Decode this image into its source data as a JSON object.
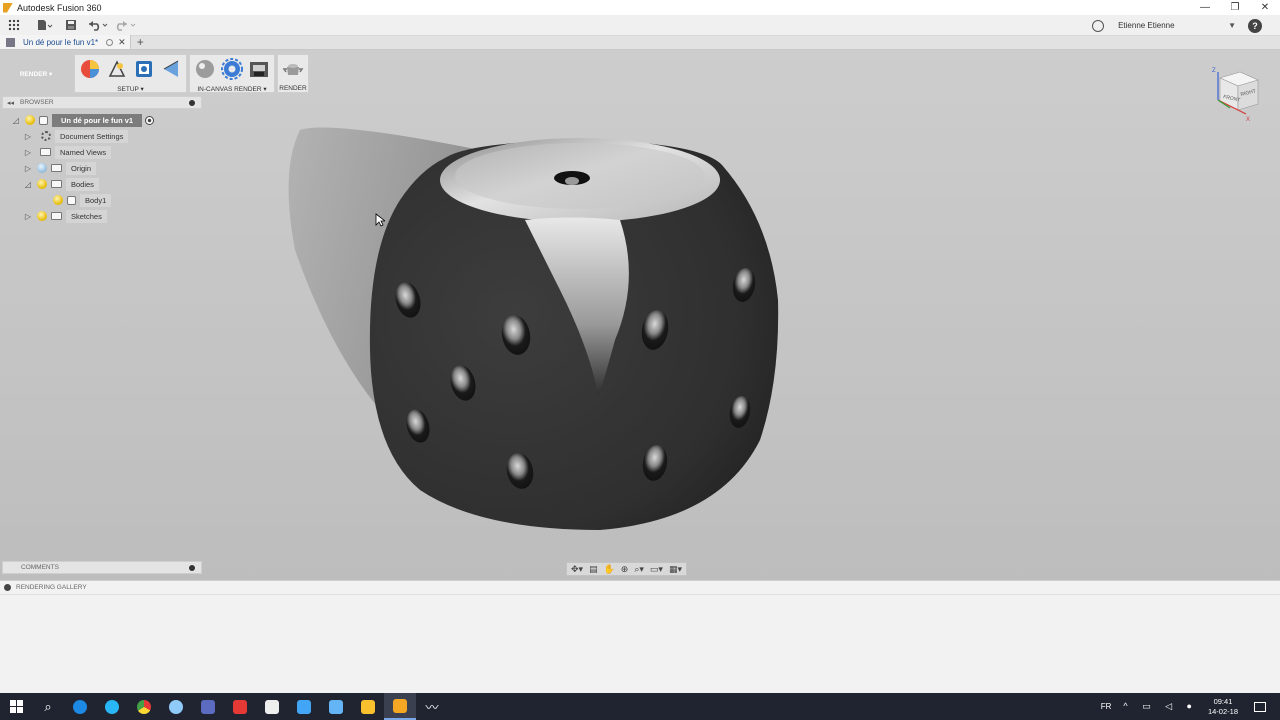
{
  "window": {
    "title": "Autodesk Fusion 360",
    "controls": [
      "—",
      "❐",
      "✕"
    ]
  },
  "appbar": {
    "user_name": "Etienne Etienne",
    "help_label": "?"
  },
  "document_tab": {
    "label": "Un dé pour le fun v1*",
    "close": "✕",
    "add": "+"
  },
  "ribbon": {
    "workspace": "RENDER ▾",
    "groups": [
      {
        "label": "SETUP ▾"
      },
      {
        "label": "IN-CANVAS RENDER ▾"
      },
      {
        "label": "RENDER"
      }
    ]
  },
  "browser": {
    "title": "BROWSER",
    "root_label": "Un dé pour le fun v1",
    "items": [
      {
        "label": "Document Settings"
      },
      {
        "label": "Named Views"
      },
      {
        "label": "Origin"
      },
      {
        "label": "Bodies"
      },
      {
        "label": "Body1"
      },
      {
        "label": "Sketches"
      }
    ]
  },
  "viewcube": {
    "front": "FRONT",
    "right": "RIGHT",
    "axis_z": "Z",
    "axis_x": "X"
  },
  "comments": {
    "title": "COMMENTS"
  },
  "gallery": {
    "title": "RENDERING GALLERY"
  },
  "taskbar": {
    "language": "FR",
    "time": "09:41",
    "date": "14-02-18"
  },
  "colors": {
    "viewport_bg": "#c6c6c6",
    "selected_row": "#7c7c7c",
    "taskbar_bg": "#1f2430",
    "die_color": "#3a3a3a"
  }
}
